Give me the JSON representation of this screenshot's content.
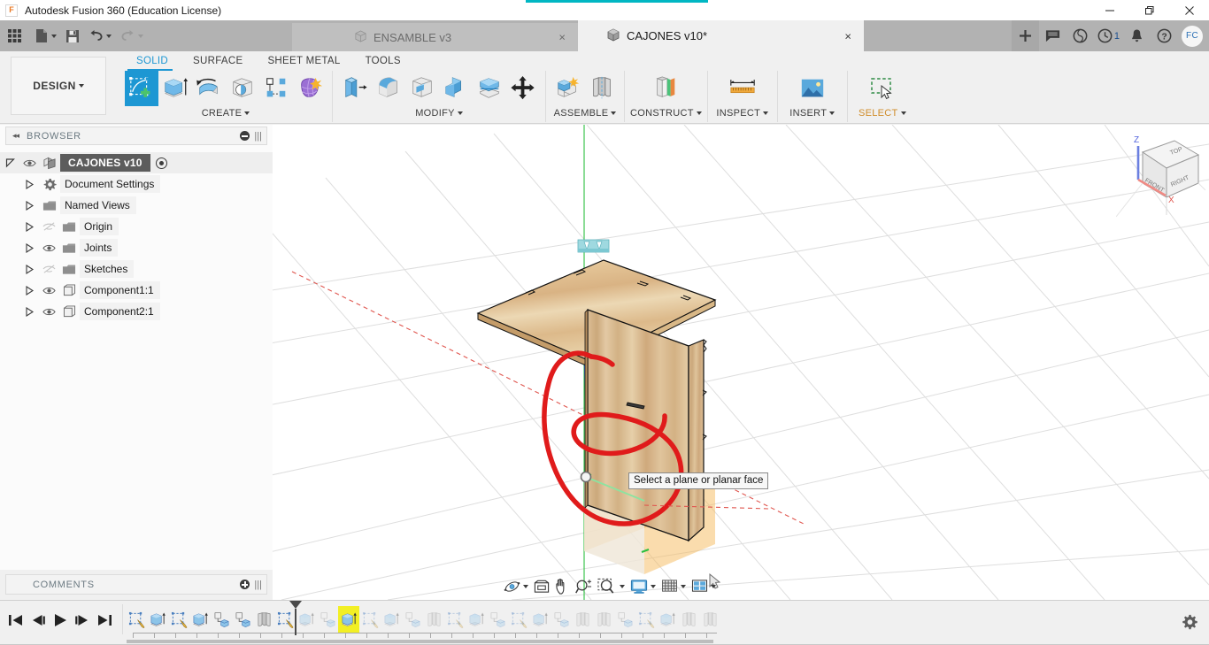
{
  "window": {
    "title": "Autodesk Fusion 360 (Education License)",
    "logo_letter": "F",
    "minimize_label": "Minimize",
    "restore_label": "Restore",
    "close_label": "Close"
  },
  "quick_access": {
    "items": [
      {
        "name": "app-grid-icon",
        "label": ""
      },
      {
        "name": "new-file-icon",
        "label": ""
      },
      {
        "name": "save-icon",
        "label": ""
      },
      {
        "name": "undo-icon",
        "label": ""
      },
      {
        "name": "redo-icon",
        "label": ""
      }
    ],
    "right_items": [
      {
        "name": "new-tab-button",
        "label": "+"
      },
      {
        "name": "comment-icon",
        "label": ""
      },
      {
        "name": "job-status-icon",
        "label": ""
      },
      {
        "name": "notification-history-icon",
        "label": "",
        "badge": "1"
      },
      {
        "name": "alerts-bell-icon",
        "label": ""
      },
      {
        "name": "help-icon",
        "label": ""
      }
    ],
    "avatar_initials": "FC"
  },
  "document_tabs": [
    {
      "label": "ENSAMBLE v3",
      "active": false,
      "close_label": "×"
    },
    {
      "label": "CAJONES v10*",
      "active": true,
      "close_label": "×"
    }
  ],
  "ribbon": {
    "workspace_label": "DESIGN",
    "tabs": [
      {
        "label": "SOLID",
        "active": true
      },
      {
        "label": "SURFACE",
        "active": false
      },
      {
        "label": "SHEET METAL",
        "active": false
      },
      {
        "label": "TOOLS",
        "active": false
      }
    ],
    "groups": [
      {
        "label": "CREATE",
        "has_dropdown": true,
        "buttons": [
          {
            "name": "create-sketch-button",
            "selected": true
          },
          {
            "name": "extrude-button",
            "selected": false
          },
          {
            "name": "revolve-button",
            "selected": false
          },
          {
            "name": "sphere-button",
            "selected": false
          },
          {
            "name": "pattern-button",
            "selected": false
          },
          {
            "name": "form-button",
            "selected": false
          }
        ]
      },
      {
        "label": "MODIFY",
        "has_dropdown": true,
        "buttons": [
          {
            "name": "press-pull-button",
            "selected": false
          },
          {
            "name": "fillet-button",
            "selected": false
          },
          {
            "name": "shell-button",
            "selected": false
          },
          {
            "name": "combine-button",
            "selected": false
          },
          {
            "name": "split-face-button",
            "selected": false
          },
          {
            "name": "move-copy-button",
            "selected": false
          }
        ]
      },
      {
        "label": "ASSEMBLE",
        "has_dropdown": true,
        "buttons": [
          {
            "name": "new-component-button",
            "selected": false
          },
          {
            "name": "joint-button",
            "selected": false
          }
        ]
      },
      {
        "label": "CONSTRUCT",
        "has_dropdown": true,
        "buttons": [
          {
            "name": "offset-plane-button",
            "selected": false
          }
        ]
      },
      {
        "label": "INSPECT",
        "has_dropdown": true,
        "buttons": [
          {
            "name": "measure-button",
            "selected": false
          }
        ]
      },
      {
        "label": "INSERT",
        "has_dropdown": true,
        "buttons": [
          {
            "name": "insert-image-button",
            "selected": false
          }
        ]
      },
      {
        "label": "SELECT",
        "has_dropdown": true,
        "buttons": [
          {
            "name": "select-window-button",
            "selected": false
          }
        ]
      }
    ]
  },
  "browser": {
    "title": "BROWSER",
    "root": {
      "label": "CAJONES v10",
      "icon": "document-icon",
      "visible": true
    },
    "items": [
      {
        "label": "Document Settings",
        "icon": "gear-icon",
        "eye": "none",
        "indent": 1
      },
      {
        "label": "Named Views",
        "icon": "folder-icon",
        "eye": "none",
        "indent": 1
      },
      {
        "label": "Origin",
        "icon": "folder-icon",
        "eye": "hidden",
        "indent": 1
      },
      {
        "label": "Joints",
        "icon": "folder-icon",
        "eye": "visible",
        "indent": 1
      },
      {
        "label": "Sketches",
        "icon": "folder-icon",
        "eye": "hidden",
        "indent": 1
      },
      {
        "label": "Component1:1",
        "icon": "component-icon",
        "eye": "visible",
        "indent": 1
      },
      {
        "label": "Component2:1",
        "icon": "component-icon",
        "eye": "visible",
        "indent": 1
      }
    ]
  },
  "comments": {
    "title": "COMMENTS"
  },
  "canvas": {
    "tooltip": "Select a plane or planar face",
    "viewcube": {
      "top_face": "TOP",
      "front_face": "FRONT",
      "right_face": "RIGHT",
      "z_axis": "Z",
      "x_axis": "X"
    },
    "colors": {
      "wood_light": "#e8cfa4",
      "wood_mid": "#d9b887",
      "wood_dark": "#c49c69",
      "plane_orange": "#f5b95c",
      "plane_cream": "#efe6d8",
      "annotation_red": "#e01b1b",
      "x_axis_red": "#e8554e",
      "y_axis_green": "#2cbf3f",
      "z_axis_blue": "#3f62d6",
      "grid_line": "#dcdcdc"
    }
  },
  "navbar": {
    "buttons": [
      {
        "name": "orbit-button",
        "has_dropdown": true
      },
      {
        "name": "look-at-button",
        "has_dropdown": false
      },
      {
        "name": "pan-button",
        "has_dropdown": false
      },
      {
        "name": "zoom-button",
        "has_dropdown": false
      },
      {
        "name": "zoom-fit-button",
        "has_dropdown": true
      },
      {
        "name": "display-settings-button",
        "has_dropdown": true
      },
      {
        "name": "grid-snaps-button",
        "has_dropdown": true
      },
      {
        "name": "viewports-button",
        "has_dropdown": true
      }
    ]
  },
  "timeline": {
    "playback": [
      {
        "name": "go-to-beginning-button"
      },
      {
        "name": "step-back-button"
      },
      {
        "name": "play-button"
      },
      {
        "name": "step-forward-button"
      },
      {
        "name": "go-to-end-button"
      }
    ],
    "marker_position_index": 8,
    "current_feature_index": 10,
    "features": [
      {
        "name": "sketch-feature",
        "type": "sketch",
        "state": "done"
      },
      {
        "name": "extrude-feature",
        "type": "extrude",
        "state": "done"
      },
      {
        "name": "sketch-feature",
        "type": "sketch",
        "state": "done"
      },
      {
        "name": "extrude-feature",
        "type": "extrude",
        "state": "done"
      },
      {
        "name": "component-feature",
        "type": "component",
        "state": "done"
      },
      {
        "name": "component-feature",
        "type": "component",
        "state": "done"
      },
      {
        "name": "joint-feature",
        "type": "joint",
        "state": "done"
      },
      {
        "name": "sketch-feature",
        "type": "sketch",
        "state": "done"
      },
      {
        "name": "extrude-feature",
        "type": "extrude",
        "state": "rolled"
      },
      {
        "name": "component-feature",
        "type": "component",
        "state": "rolled"
      },
      {
        "name": "extrude-feature",
        "type": "extrude",
        "state": "current"
      },
      {
        "name": "sketch-feature",
        "type": "sketch",
        "state": "rolled"
      },
      {
        "name": "extrude-feature",
        "type": "extrude",
        "state": "rolled"
      },
      {
        "name": "component-feature",
        "type": "component",
        "state": "rolled"
      },
      {
        "name": "joint-feature",
        "type": "joint",
        "state": "rolled"
      },
      {
        "name": "sketch-feature",
        "type": "sketch",
        "state": "rolled"
      },
      {
        "name": "extrude-feature",
        "type": "extrude",
        "state": "rolled"
      },
      {
        "name": "component-feature",
        "type": "component",
        "state": "rolled"
      },
      {
        "name": "sketch-feature",
        "type": "sketch",
        "state": "rolled"
      },
      {
        "name": "extrude-feature",
        "type": "extrude",
        "state": "rolled"
      },
      {
        "name": "component-feature",
        "type": "component",
        "state": "rolled"
      },
      {
        "name": "joint-feature",
        "type": "joint",
        "state": "rolled"
      },
      {
        "name": "joint-feature",
        "type": "joint",
        "state": "rolled"
      },
      {
        "name": "component-feature",
        "type": "component",
        "state": "rolled"
      },
      {
        "name": "sketch-feature",
        "type": "sketch",
        "state": "rolled"
      },
      {
        "name": "extrude-feature",
        "type": "extrude",
        "state": "rolled"
      },
      {
        "name": "joint-feature",
        "type": "joint",
        "state": "rolled"
      },
      {
        "name": "joint-feature",
        "type": "joint",
        "state": "rolled"
      }
    ],
    "settings_label": ""
  }
}
